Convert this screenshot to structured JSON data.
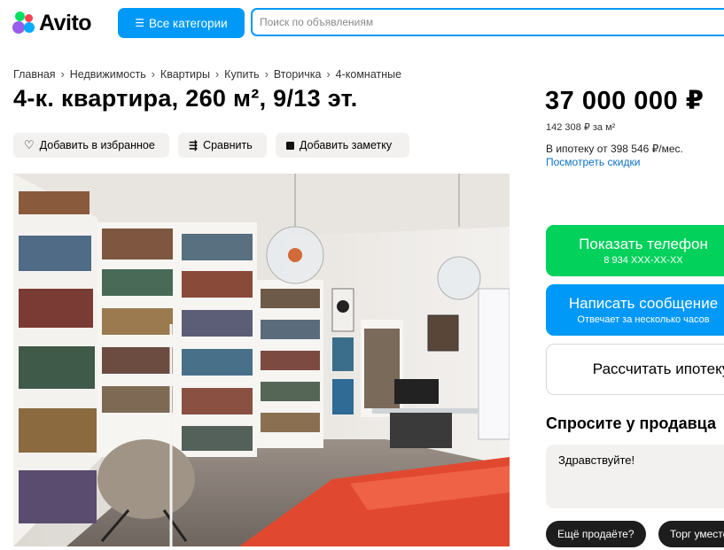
{
  "header": {
    "logo_text": "Avito",
    "categories_label": "Все категории",
    "search_placeholder": "Поиск по объявлениям"
  },
  "breadcrumbs": [
    "Главная",
    "Недвижимость",
    "Квартиры",
    "Купить",
    "Вторичка",
    "4-комнатные"
  ],
  "title": "4-к. квартира, 260 м², 9/13 эт.",
  "actions": {
    "favorite": "Добавить в избранное",
    "compare": "Сравнить",
    "note": "Добавить заметку"
  },
  "price": {
    "total": "37 000 000 ₽",
    "per_m2": "142 308 ₽ за м²",
    "mortgage": "В ипотеку от 398 546 ₽/мес.",
    "discounts_link": "Посмотреть скидки"
  },
  "buttons": {
    "show_phone": "Показать телефон",
    "phone_masked": "8 934 XXX-XX-XX",
    "write_message": "Написать сообщение",
    "reply_time": "Отвечает за несколько часов",
    "mortgage_calc": "Рассчитать ипотеку"
  },
  "ask_seller": {
    "title": "Спросите у продавца",
    "message": "Здравствуйте!",
    "chips": [
      "Ещё продаёте?",
      "Торг уместен?"
    ]
  },
  "colors": {
    "blue": "#0099f7",
    "green": "#02d15c",
    "link": "#0a72c7"
  }
}
